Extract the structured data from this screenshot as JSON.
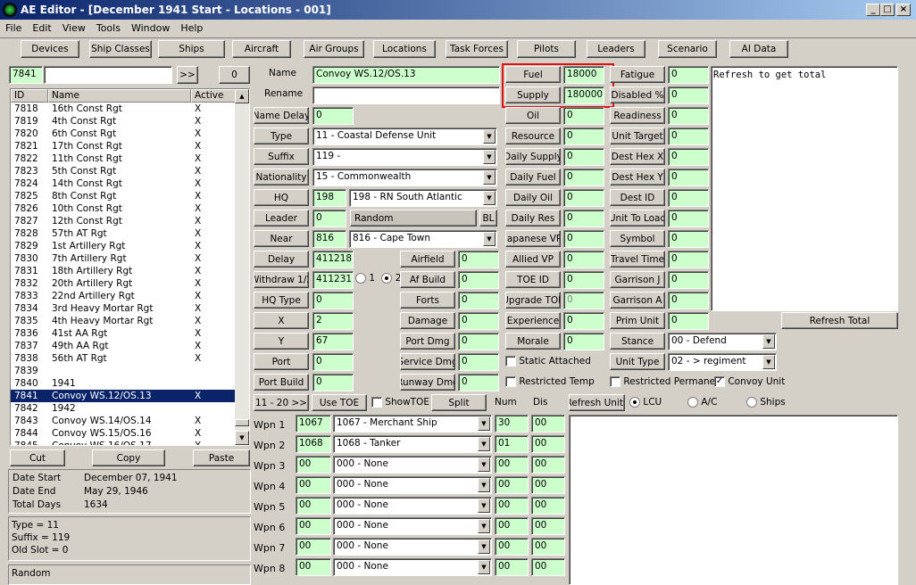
{
  "window": {
    "title": "AE Editor - [December 1941 Start - Locations - 001]"
  },
  "menu": [
    "File",
    "Edit",
    "View",
    "Tools",
    "Window",
    "Help"
  ],
  "nav": [
    "Devices",
    "Ship Classes",
    "Ships",
    "Aircraft",
    "Air Groups",
    "Locations",
    "Task Forces",
    "Pilots",
    "Leaders",
    "Scenario",
    "AI Data"
  ],
  "search": {
    "id": "7841",
    "text": "",
    "go": ">>",
    "count": "0"
  },
  "list": {
    "headers": [
      "ID",
      "Name",
      "Active"
    ],
    "rows": [
      [
        "7818",
        "16th Const Rgt",
        "X"
      ],
      [
        "7819",
        "4th Const Rgt",
        "X"
      ],
      [
        "7820",
        "6th Const Rgt",
        "X"
      ],
      [
        "7821",
        "17th Const Rgt",
        "X"
      ],
      [
        "7822",
        "11th Const Rgt",
        "X"
      ],
      [
        "7823",
        "5th Const Rgt",
        "X"
      ],
      [
        "7824",
        "14th Const Rgt",
        "X"
      ],
      [
        "7825",
        "8th Const Rgt",
        "X"
      ],
      [
        "7826",
        "10th Const Rgt",
        "X"
      ],
      [
        "7827",
        "12th Const Rgt",
        "X"
      ],
      [
        "7828",
        "57th AT Rgt",
        "X"
      ],
      [
        "7829",
        "1st Artillery Rgt",
        "X"
      ],
      [
        "7830",
        "7th Artillery Rgt",
        "X"
      ],
      [
        "7831",
        "18th Artillery Rgt",
        "X"
      ],
      [
        "7832",
        "20th Artillery Rgt",
        "X"
      ],
      [
        "7833",
        "22nd Artillery Rgt",
        "X"
      ],
      [
        "7834",
        "3rd Heavy Mortar Rgt",
        "X"
      ],
      [
        "7835",
        "4th Heavy Mortar Rgt",
        "X"
      ],
      [
        "7836",
        "41st AA Rgt",
        "X"
      ],
      [
        "7837",
        "49th AA Rgt",
        "X"
      ],
      [
        "7838",
        "56th AT Rgt",
        "X"
      ],
      [
        "7839",
        "",
        ""
      ],
      [
        "7840",
        "1941",
        ""
      ],
      [
        "7841",
        "Convoy WS.12/OS.13",
        "X"
      ],
      [
        "7842",
        "1942",
        ""
      ],
      [
        "7843",
        "Convoy WS.14/OS.14",
        "X"
      ],
      [
        "7844",
        "Convoy WS.15/OS.16",
        "X"
      ],
      [
        "7845",
        "Convoy WS.16/OS.17",
        "X"
      ]
    ]
  },
  "clip": {
    "cut": "Cut",
    "copy": "Copy",
    "paste": "Paste"
  },
  "dates": {
    "start_label": "Date Start",
    "start": "December 07, 1941",
    "end_label": "Date End",
    "end": "May 29, 1946",
    "total_label": "Total Days",
    "total": "1634"
  },
  "info": [
    "Type = 11",
    "Suffix = 119",
    "Old Slot = 0"
  ],
  "leader_text": "Random",
  "form": {
    "name_label": "Name",
    "name": "Convoy WS.12/OS.13",
    "rename_label": "Rename",
    "rename": "",
    "name_delay_label": "Name Delay",
    "name_delay": "0",
    "type_label": "Type",
    "type": "11 - Coastal Defense Unit",
    "suffix_label": "Suffix",
    "suffix": "119 -",
    "nationality_label": "Nationality",
    "nationality": "15 - Commonwealth",
    "hq_label": "HQ",
    "hq_id": "198",
    "hq": "198 - RN South Atlantic",
    "leader_label": "Leader",
    "leader_id": "0",
    "leader": "Random",
    "bl": "BL",
    "near_label": "Near",
    "near_id": "816",
    "near": "816 - Cape Town",
    "delay_label": "Delay",
    "delay": "411218",
    "withdraw_label": "Withdraw 1/2",
    "withdraw": "411231",
    "r1": "1",
    "r2": "2",
    "hqtype_label": "HQ Type",
    "hqtype": "0",
    "x_label": "X",
    "x": "2",
    "y_label": "Y",
    "y": "67",
    "port_label": "Port",
    "port": "0",
    "portbuild_label": "Port Build",
    "portbuild": "0",
    "airfield_label": "Airfield",
    "airfield": "0",
    "afbuild_label": "Af Build",
    "afbuild": "0",
    "forts_label": "Forts",
    "forts": "0",
    "damage_label": "Damage",
    "damage": "0",
    "portdmg_label": "Port Dmg",
    "portdmg": "0",
    "servicedmg_label": "Service Dmg",
    "servicedmg": "0",
    "runwaydmg_label": "Runway Dmg",
    "runwaydmg": "0"
  },
  "mid": {
    "fuel_label": "Fuel",
    "fuel": "18000",
    "supply_label": "Supply",
    "supply": "180000",
    "oil_label": "Oil",
    "oil": "0",
    "resource_label": "Resource",
    "resource": "0",
    "dsupply_label": "Daily Supply",
    "dsupply": "0",
    "dfuel_label": "Daily Fuel",
    "dfuel": "0",
    "doil_label": "Daily Oil",
    "doil": "0",
    "dres_label": "Daily Res",
    "dres": "0",
    "jvp_label": "Japanese VP",
    "jvp": "0",
    "avp_label": "Allied VP",
    "avp": "0",
    "toeid_label": "TOE ID",
    "toeid": "0",
    "upgrade_label": "Upgrade TOE",
    "upgrade": "0",
    "exp_label": "Experience",
    "exp": "0",
    "morale_label": "Morale",
    "morale": "0",
    "static_label": "Static Attached",
    "restricted_label": "Restricted Temp"
  },
  "right": {
    "fatigue_label": "Fatigue",
    "fatigue": "0",
    "disabled_label": "Disabled %",
    "disabled": "0",
    "readiness_label": "Readiness",
    "readiness": "0",
    "unittarget_label": "Unit Target",
    "unittarget": "0",
    "desthexx_label": "Dest Hex X",
    "desthexx": "0",
    "desthexy_label": "Dest Hex Y",
    "desthexy": "0",
    "destid_label": "Dest ID",
    "destid": "0",
    "unittoload_label": "Unit To Load",
    "unittoload": "0",
    "symbol_label": "Symbol",
    "symbol": "0",
    "traveltime_label": "Travel Time",
    "traveltime": "0",
    "garrisonj_label": "Garrison J",
    "garrisonj": "0",
    "garrisona_label": "Garrison A",
    "garrisona": "0",
    "primunit_label": "Prim Unit",
    "primunit": "0",
    "stance_label": "Stance",
    "stance": "00 - Defend",
    "unittype_label": "Unit Type",
    "unittype": "02 - > regiment",
    "restrictedperm_label": "Restricted Permanent",
    "convoy_label": "Convoy Unit",
    "total_text": "Refresh to get total",
    "refresh_total": "Refresh Total"
  },
  "weapons": {
    "page_btn": "11 - 20 >>",
    "usetoe": "Use TOE",
    "showtoe": "ShowTOE",
    "split": "Split",
    "num_label": "Num",
    "dis_label": "Dis",
    "refresh_units": "Refresh Units",
    "lcu": "LCU",
    "ac": "A/C",
    "ships": "Ships",
    "rows": [
      {
        "label": "Wpn 1",
        "id": "1067",
        "name": "1067 - Merchant Ship",
        "num": "30",
        "dis": "00"
      },
      {
        "label": "Wpn 2",
        "id": "1068",
        "name": "1068 - Tanker",
        "num": "01",
        "dis": "00"
      },
      {
        "label": "Wpn 3",
        "id": "00",
        "name": "000 - None",
        "num": "00",
        "dis": "00"
      },
      {
        "label": "Wpn 4",
        "id": "00",
        "name": "000 - None",
        "num": "00",
        "dis": "00"
      },
      {
        "label": "Wpn 5",
        "id": "00",
        "name": "000 - None",
        "num": "00",
        "dis": "00"
      },
      {
        "label": "Wpn 6",
        "id": "00",
        "name": "000 - None",
        "num": "00",
        "dis": "00"
      },
      {
        "label": "Wpn 7",
        "id": "00",
        "name": "000 - None",
        "num": "00",
        "dis": "00"
      },
      {
        "label": "Wpn 8",
        "id": "00",
        "name": "000 - None",
        "num": "00",
        "dis": "00"
      }
    ]
  },
  "colors": {
    "highlight_box": "#e01010",
    "field_green": "#ccffcc",
    "selection": "#0a246a"
  }
}
